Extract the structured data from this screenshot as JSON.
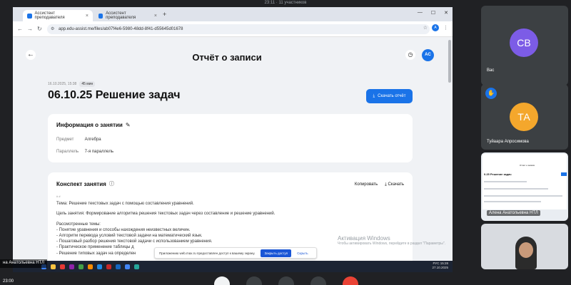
{
  "meeting": {
    "top_info": "23:11 · 11 участников",
    "time": "23:00"
  },
  "browser": {
    "tabs": [
      {
        "label": "Ассистент преподавателя",
        "active": true
      },
      {
        "label": "Ассистент преподавателя",
        "active": false
      }
    ],
    "url": "app.edu-assist.me/files/ab07f4e6-5980-48dd-8f41-d55645d01678",
    "avatar": "A"
  },
  "page": {
    "title": "Отчёт о записи",
    "avatar_initials": "AC",
    "meta_date": "16.10.2025, 15:38",
    "meta_duration": "45 мин",
    "record_title": "06.10.25 Решение задач",
    "download_label": "Скачать отчёт",
    "info_card": {
      "heading": "Информация о занятии",
      "rows": [
        {
          "label": "Предмет",
          "value": "Алгебра"
        },
        {
          "label": "Параллель",
          "value": "7-я параллель"
        }
      ]
    },
    "summary_card": {
      "heading": "Конспект занятия",
      "copy_label": "Копировать",
      "download_label": "Скачать",
      "marker": "# #",
      "topic": "Тема: Решение текстовых задач с помощью составления уравнений.",
      "goal": "Цель занятия: Формирование алгоритма решения текстовых задач через составление и решение уравнений.",
      "discussed_heading": "Рассмотренные темы:",
      "items": [
        "- Понятие уравнения и способы нахождения неизвестных величин.",
        "- Алгоритм перевода условий текстовой задачи на математический язык.",
        "- Пошаговый разбор решения текстовой задачи с использованием уравнения.",
        "- Практическое применение таблицы д",
        "- Решение типовых задач на определен"
      ]
    }
  },
  "toast": {
    "text": "Приложению web.max.ru предоставлен доступ к вашему экрану.",
    "allow": "Закрыть доступ",
    "hide": "Скрыть"
  },
  "watermark": {
    "title": "Активация Windows",
    "sub": "Чтобы активировать Windows, перейдите в раздел \"Параметры\"."
  },
  "taskbar": {
    "lang": "РУС",
    "clock_time": "15:28",
    "clock_date": "27.10.2025"
  },
  "presenter_name": "на Анатольевна НТЛ",
  "participants": [
    {
      "initials": "СВ",
      "name": "Вас",
      "color": "#7c5ce6"
    },
    {
      "initials": "ТА",
      "name": "Туйаара Апросимова",
      "color": "#f4a72c"
    },
    {
      "name": "Алена Анатольевна НТЛ"
    }
  ],
  "mini_preview": {
    "heading": "Отчёт о записи",
    "title": "0.25 Решение задач"
  }
}
